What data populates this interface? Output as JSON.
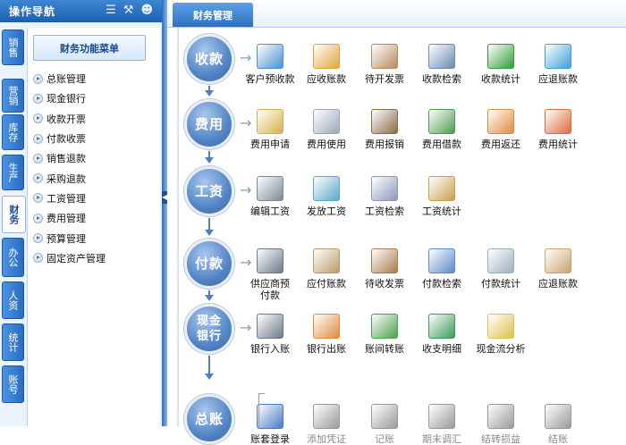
{
  "nav": {
    "title": "操作导航",
    "vertical_tabs": [
      "销售",
      "营销",
      "库存",
      "生产",
      "财务",
      "办公",
      "人资",
      "统计",
      "账号"
    ],
    "active_tab": "财务",
    "menu_title": "财务功能菜单",
    "menu_items": [
      "总账管理",
      "现金银行",
      "收款开票",
      "付款收票",
      "销售退款",
      "采购退款",
      "工资管理",
      "费用管理",
      "预算管理",
      "固定资产管理"
    ]
  },
  "main": {
    "tab": "财务管理",
    "rows": [
      {
        "label": "收款",
        "items": [
          {
            "label": "客户预收款",
            "icon": "customer-prepay-icon",
            "color": "#4a8fd8"
          },
          {
            "label": "应收账款",
            "icon": "receivable-icon",
            "color": "#e0a43a"
          },
          {
            "label": "待开发票",
            "icon": "pending-invoice-icon",
            "color": "#b58a5a"
          },
          {
            "label": "收款检索",
            "icon": "receipt-search-icon",
            "color": "#6b8ab0"
          },
          {
            "label": "收款统计",
            "icon": "receipt-stats-icon",
            "color": "#2f9e3a"
          },
          {
            "label": "应退账款",
            "icon": "refund-due-icon",
            "color": "#3aa0d8"
          }
        ]
      },
      {
        "label": "费用",
        "items": [
          {
            "label": "费用申请",
            "icon": "expense-apply-icon",
            "color": "#d8b04a"
          },
          {
            "label": "费用使用",
            "icon": "expense-use-icon",
            "color": "#9aa8b8"
          },
          {
            "label": "费用报销",
            "icon": "expense-reimburse-icon",
            "color": "#8a6b4a"
          },
          {
            "label": "费用借款",
            "icon": "expense-loan-icon",
            "color": "#4f9a52"
          },
          {
            "label": "费用返还",
            "icon": "expense-return-icon",
            "color": "#e08a3a"
          },
          {
            "label": "费用统计",
            "icon": "expense-stats-icon",
            "color": "#e06a3a"
          }
        ]
      },
      {
        "label": "工资",
        "items": [
          {
            "label": "编辑工资",
            "icon": "edit-salary-icon",
            "color": "#7a8a98"
          },
          {
            "label": "发放工资",
            "icon": "pay-salary-icon",
            "color": "#5aa8c8"
          },
          {
            "label": "工资检索",
            "icon": "salary-search-icon",
            "color": "#8a98b8"
          },
          {
            "label": "工资统计",
            "icon": "salary-stats-icon",
            "color": "#c8a04a"
          }
        ]
      },
      {
        "label": "付款",
        "items": [
          {
            "label": "供应商预付款",
            "icon": "supplier-prepay-icon",
            "color": "#6a7a8a"
          },
          {
            "label": "应付账款",
            "icon": "payable-icon",
            "color": "#b89a6a"
          },
          {
            "label": "待收发票",
            "icon": "invoice-receive-icon",
            "color": "#a87a4a"
          },
          {
            "label": "付款检索",
            "icon": "payment-search-icon",
            "color": "#5a8ac8"
          },
          {
            "label": "付款统计",
            "icon": "payment-stats-icon",
            "color": "#9ab0c0"
          },
          {
            "label": "应退账款",
            "icon": "refund-due-icon",
            "color": "#c8a46a"
          }
        ]
      },
      {
        "label": "现金银行",
        "items": [
          {
            "label": "银行入账",
            "icon": "bank-deposit-icon",
            "color": "#6a7a8a"
          },
          {
            "label": "银行出账",
            "icon": "bank-withdraw-icon",
            "color": "#e08a3a"
          },
          {
            "label": "账间转账",
            "icon": "transfer-icon",
            "color": "#4aa04a"
          },
          {
            "label": "收支明细",
            "icon": "cashflow-detail-icon",
            "color": "#3a9a5a"
          },
          {
            "label": "现金流分析",
            "icon": "cashflow-analysis-icon",
            "color": "#e0c04a"
          }
        ]
      },
      {
        "label": "总账",
        "items": [
          {
            "label": "账套登录",
            "icon": "ledger-login-icon",
            "color": "#4a7ac8",
            "disabled": false
          },
          {
            "label": "添加凭证",
            "icon": "add-voucher-icon",
            "color": "#9a9a9a",
            "disabled": true
          },
          {
            "label": "记账",
            "icon": "bookkeeping-icon",
            "color": "#9a9a9a",
            "disabled": true
          },
          {
            "label": "期末调汇",
            "icon": "period-exchange-icon",
            "color": "#9a9a9a",
            "disabled": true
          },
          {
            "label": "结转损益",
            "icon": "carry-forward-icon",
            "color": "#9a9a9a",
            "disabled": true
          },
          {
            "label": "结账",
            "icon": "close-account-icon",
            "color": "#9a9a9a",
            "disabled": true
          }
        ]
      }
    ]
  },
  "colors": {
    "accent": "#2a6cc1",
    "circle": "#5385c6"
  }
}
